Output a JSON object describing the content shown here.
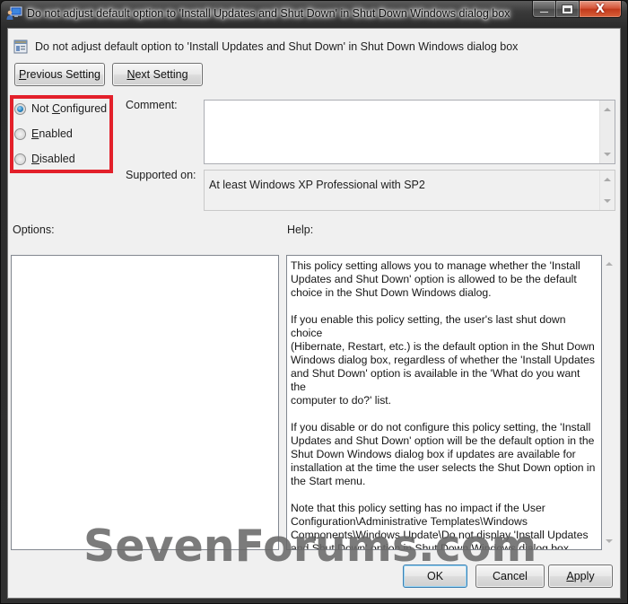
{
  "window": {
    "title": "Do not adjust default option to 'Install Updates and Shut Down' in Shut Down Windows dialog box",
    "caption_buttons": {
      "minimize": "minimize-icon",
      "maximize": "maximize-icon",
      "close": "close-icon"
    }
  },
  "policy": {
    "title": "Do not adjust default option to 'Install Updates and Shut Down' in Shut Down Windows dialog box",
    "icon": "policy-setting-icon"
  },
  "nav": {
    "previous_label_prefix": "",
    "previous_accel": "P",
    "previous_label_rest": "revious Setting",
    "next_accel": "N",
    "next_label_rest": "ext Setting"
  },
  "state": {
    "options": [
      {
        "pre": "Not ",
        "accel": "C",
        "post": "onfigured",
        "checked": true
      },
      {
        "pre": "",
        "accel": "E",
        "post": "nabled",
        "checked": false
      },
      {
        "pre": "",
        "accel": "D",
        "post": "isabled",
        "checked": false
      }
    ],
    "highlight_color": "#e3202a"
  },
  "comment": {
    "label": "Comment:",
    "value": ""
  },
  "supported": {
    "label": "Supported on:",
    "value": "At least Windows XP Professional with SP2"
  },
  "options_section": {
    "label": "Options:"
  },
  "help_section": {
    "label": "Help:",
    "text": "This policy setting allows you to manage whether the 'Install\nUpdates and Shut Down' option is allowed to be the default\nchoice in the Shut Down Windows dialog.\n\nIf you enable this policy setting, the user's last shut down choice\n(Hibernate, Restart, etc.) is the default option in the Shut Down\nWindows dialog box, regardless of whether the 'Install Updates\nand Shut Down' option is available in the 'What do you want the\ncomputer to do?' list.\n\nIf you disable or do not configure this policy setting, the 'Install\nUpdates and Shut Down' option will be the default option in the\nShut Down Windows dialog box if updates are available for\ninstallation at the time the user selects the Shut Down option in\nthe Start menu.\n\nNote that this policy setting has no impact if the User\nConfiguration\\Administrative Templates\\Windows\nComponents\\Windows Update\\Do not display 'Install Updates\nand Shut Down' option in Shut Down Windows dialog box policy\nsetting is enabled."
  },
  "footer": {
    "ok_label": "OK",
    "cancel_label": "Cancel",
    "apply_accel": "A",
    "apply_rest": "pply"
  },
  "watermark": "SevenForums.com"
}
